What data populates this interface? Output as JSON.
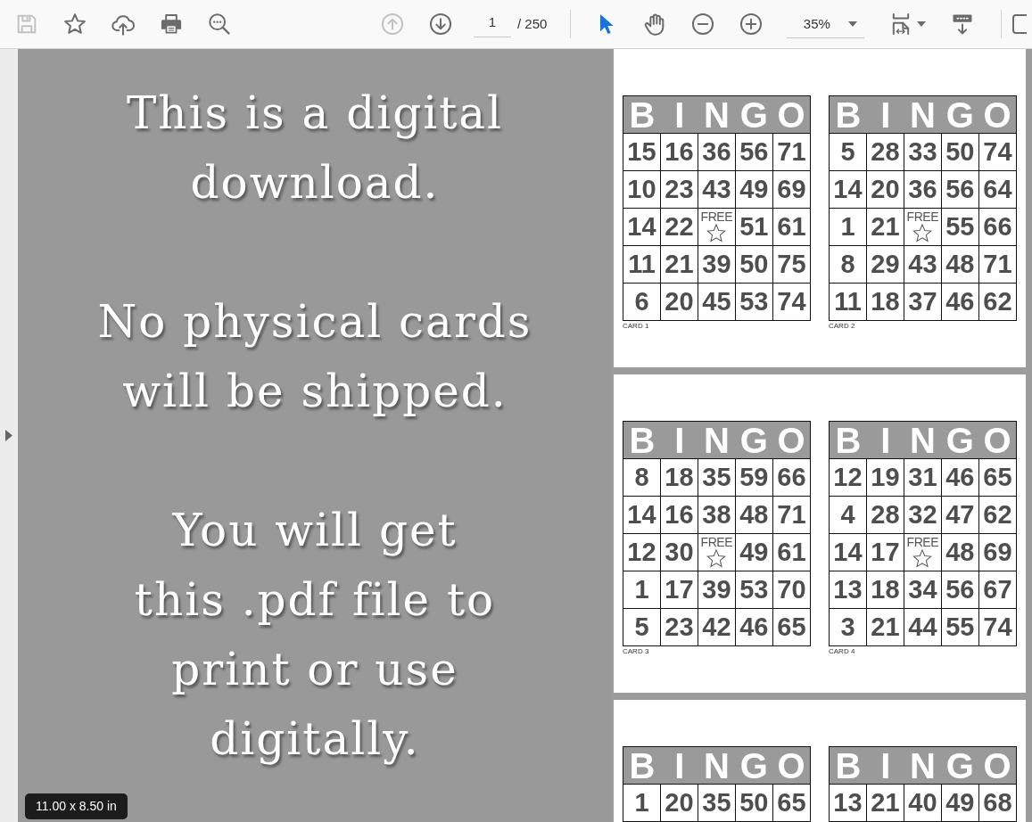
{
  "toolbar": {
    "file_tools": [
      {
        "kind": "save",
        "disabled": true
      },
      {
        "kind": "star",
        "disabled": false
      },
      {
        "kind": "upload",
        "disabled": false
      },
      {
        "kind": "print",
        "disabled": false
      },
      {
        "kind": "find",
        "disabled": false
      }
    ],
    "page_nav": {
      "buttons": [
        {
          "kind": "previous",
          "disabled": true
        },
        {
          "kind": "next",
          "disabled": false
        }
      ],
      "page_field": {
        "value": "1"
      },
      "page_count": "/ 250"
    },
    "modes": [
      {
        "kind": "select",
        "selected": true
      },
      {
        "kind": "hand",
        "selected": false
      }
    ],
    "zoom": {
      "buttons": [
        {
          "kind": "zoom_out"
        },
        {
          "kind": "zoom_in"
        }
      ],
      "field": {
        "value": "35%"
      }
    },
    "view_tools": [
      {
        "kind": "page_fit",
        "menu": true
      },
      {
        "kind": "scroll",
        "menu": false
      }
    ]
  },
  "sidebar": {
    "expanded": false
  },
  "cover_page": {
    "paragraphs": [
      "This is a digital\ndownload.",
      "No physical cards\nwill be shipped.",
      "You will get\nthis .pdf file to\nprint or use\ndigitally."
    ]
  },
  "pages": [
    {
      "cards": [
        {
          "header": [
            "B",
            "I",
            "N",
            "G",
            "O"
          ],
          "rows": [
            [
              {
                "kind": "number",
                "text": "15"
              },
              {
                "kind": "number",
                "text": "16"
              },
              {
                "kind": "number",
                "text": "36"
              },
              {
                "kind": "number",
                "text": "56"
              },
              {
                "kind": "number",
                "text": "71"
              }
            ],
            [
              {
                "kind": "number",
                "text": "10"
              },
              {
                "kind": "number",
                "text": "23"
              },
              {
                "kind": "number",
                "text": "43"
              },
              {
                "kind": "number",
                "text": "49"
              },
              {
                "kind": "number",
                "text": "69"
              }
            ],
            [
              {
                "kind": "number",
                "text": "14"
              },
              {
                "kind": "number",
                "text": "22"
              },
              {
                "kind": "free",
                "text": "FREE"
              },
              {
                "kind": "number",
                "text": "51"
              },
              {
                "kind": "number",
                "text": "61"
              }
            ],
            [
              {
                "kind": "number",
                "text": "11"
              },
              {
                "kind": "number",
                "text": "21"
              },
              {
                "kind": "number",
                "text": "39"
              },
              {
                "kind": "number",
                "text": "50"
              },
              {
                "kind": "number",
                "text": "75"
              }
            ],
            [
              {
                "kind": "number",
                "text": "6"
              },
              {
                "kind": "number",
                "text": "20"
              },
              {
                "kind": "number",
                "text": "45"
              },
              {
                "kind": "number",
                "text": "53"
              },
              {
                "kind": "number",
                "text": "74"
              }
            ]
          ],
          "label": "CARD 1"
        },
        {
          "header": [
            "B",
            "I",
            "N",
            "G",
            "O"
          ],
          "rows": [
            [
              {
                "kind": "number",
                "text": "5"
              },
              {
                "kind": "number",
                "text": "28"
              },
              {
                "kind": "number",
                "text": "33"
              },
              {
                "kind": "number",
                "text": "50"
              },
              {
                "kind": "number",
                "text": "74"
              }
            ],
            [
              {
                "kind": "number",
                "text": "14"
              },
              {
                "kind": "number",
                "text": "20"
              },
              {
                "kind": "number",
                "text": "36"
              },
              {
                "kind": "number",
                "text": "56"
              },
              {
                "kind": "number",
                "text": "64"
              }
            ],
            [
              {
                "kind": "number",
                "text": "1"
              },
              {
                "kind": "number",
                "text": "21"
              },
              {
                "kind": "free",
                "text": "FREE"
              },
              {
                "kind": "number",
                "text": "55"
              },
              {
                "kind": "number",
                "text": "66"
              }
            ],
            [
              {
                "kind": "number",
                "text": "8"
              },
              {
                "kind": "number",
                "text": "29"
              },
              {
                "kind": "number",
                "text": "43"
              },
              {
                "kind": "number",
                "text": "48"
              },
              {
                "kind": "number",
                "text": "71"
              }
            ],
            [
              {
                "kind": "number",
                "text": "11"
              },
              {
                "kind": "number",
                "text": "18"
              },
              {
                "kind": "number",
                "text": "37"
              },
              {
                "kind": "number",
                "text": "46"
              },
              {
                "kind": "number",
                "text": "62"
              }
            ]
          ],
          "label": "CARD 2"
        }
      ]
    },
    {
      "cards": [
        {
          "header": [
            "B",
            "I",
            "N",
            "G",
            "O"
          ],
          "rows": [
            [
              {
                "kind": "number",
                "text": "8"
              },
              {
                "kind": "number",
                "text": "18"
              },
              {
                "kind": "number",
                "text": "35"
              },
              {
                "kind": "number",
                "text": "59"
              },
              {
                "kind": "number",
                "text": "66"
              }
            ],
            [
              {
                "kind": "number",
                "text": "14"
              },
              {
                "kind": "number",
                "text": "16"
              },
              {
                "kind": "number",
                "text": "38"
              },
              {
                "kind": "number",
                "text": "48"
              },
              {
                "kind": "number",
                "text": "71"
              }
            ],
            [
              {
                "kind": "number",
                "text": "12"
              },
              {
                "kind": "number",
                "text": "30"
              },
              {
                "kind": "free",
                "text": "FREE"
              },
              {
                "kind": "number",
                "text": "49"
              },
              {
                "kind": "number",
                "text": "61"
              }
            ],
            [
              {
                "kind": "number",
                "text": "1"
              },
              {
                "kind": "number",
                "text": "17"
              },
              {
                "kind": "number",
                "text": "39"
              },
              {
                "kind": "number",
                "text": "53"
              },
              {
                "kind": "number",
                "text": "70"
              }
            ],
            [
              {
                "kind": "number",
                "text": "5"
              },
              {
                "kind": "number",
                "text": "23"
              },
              {
                "kind": "number",
                "text": "42"
              },
              {
                "kind": "number",
                "text": "46"
              },
              {
                "kind": "number",
                "text": "65"
              }
            ]
          ],
          "label": "CARD 3"
        },
        {
          "header": [
            "B",
            "I",
            "N",
            "G",
            "O"
          ],
          "rows": [
            [
              {
                "kind": "number",
                "text": "12"
              },
              {
                "kind": "number",
                "text": "19"
              },
              {
                "kind": "number",
                "text": "31"
              },
              {
                "kind": "number",
                "text": "46"
              },
              {
                "kind": "number",
                "text": "65"
              }
            ],
            [
              {
                "kind": "number",
                "text": "4"
              },
              {
                "kind": "number",
                "text": "28"
              },
              {
                "kind": "number",
                "text": "32"
              },
              {
                "kind": "number",
                "text": "47"
              },
              {
                "kind": "number",
                "text": "62"
              }
            ],
            [
              {
                "kind": "number",
                "text": "14"
              },
              {
                "kind": "number",
                "text": "17"
              },
              {
                "kind": "free",
                "text": "FREE"
              },
              {
                "kind": "number",
                "text": "48"
              },
              {
                "kind": "number",
                "text": "69"
              }
            ],
            [
              {
                "kind": "number",
                "text": "13"
              },
              {
                "kind": "number",
                "text": "18"
              },
              {
                "kind": "number",
                "text": "34"
              },
              {
                "kind": "number",
                "text": "56"
              },
              {
                "kind": "number",
                "text": "67"
              }
            ],
            [
              {
                "kind": "number",
                "text": "3"
              },
              {
                "kind": "number",
                "text": "21"
              },
              {
                "kind": "number",
                "text": "44"
              },
              {
                "kind": "number",
                "text": "55"
              },
              {
                "kind": "number",
                "text": "74"
              }
            ]
          ],
          "label": "CARD 4"
        }
      ]
    },
    {
      "cards": [
        {
          "header": [
            "B",
            "I",
            "N",
            "G",
            "O"
          ],
          "rows": [
            [
              {
                "kind": "number",
                "text": "1"
              },
              {
                "kind": "number",
                "text": "20"
              },
              {
                "kind": "number",
                "text": "35"
              },
              {
                "kind": "number",
                "text": "50"
              },
              {
                "kind": "number",
                "text": "65"
              }
            ]
          ]
        },
        {
          "header": [
            "B",
            "I",
            "N",
            "G",
            "O"
          ],
          "rows": [
            [
              {
                "kind": "number",
                "text": "13"
              },
              {
                "kind": "number",
                "text": "21"
              },
              {
                "kind": "number",
                "text": "40"
              },
              {
                "kind": "number",
                "text": "49"
              },
              {
                "kind": "number",
                "text": "68"
              }
            ]
          ]
        }
      ]
    }
  ],
  "page_size_tooltip": "11.00 x 8.50 in"
}
